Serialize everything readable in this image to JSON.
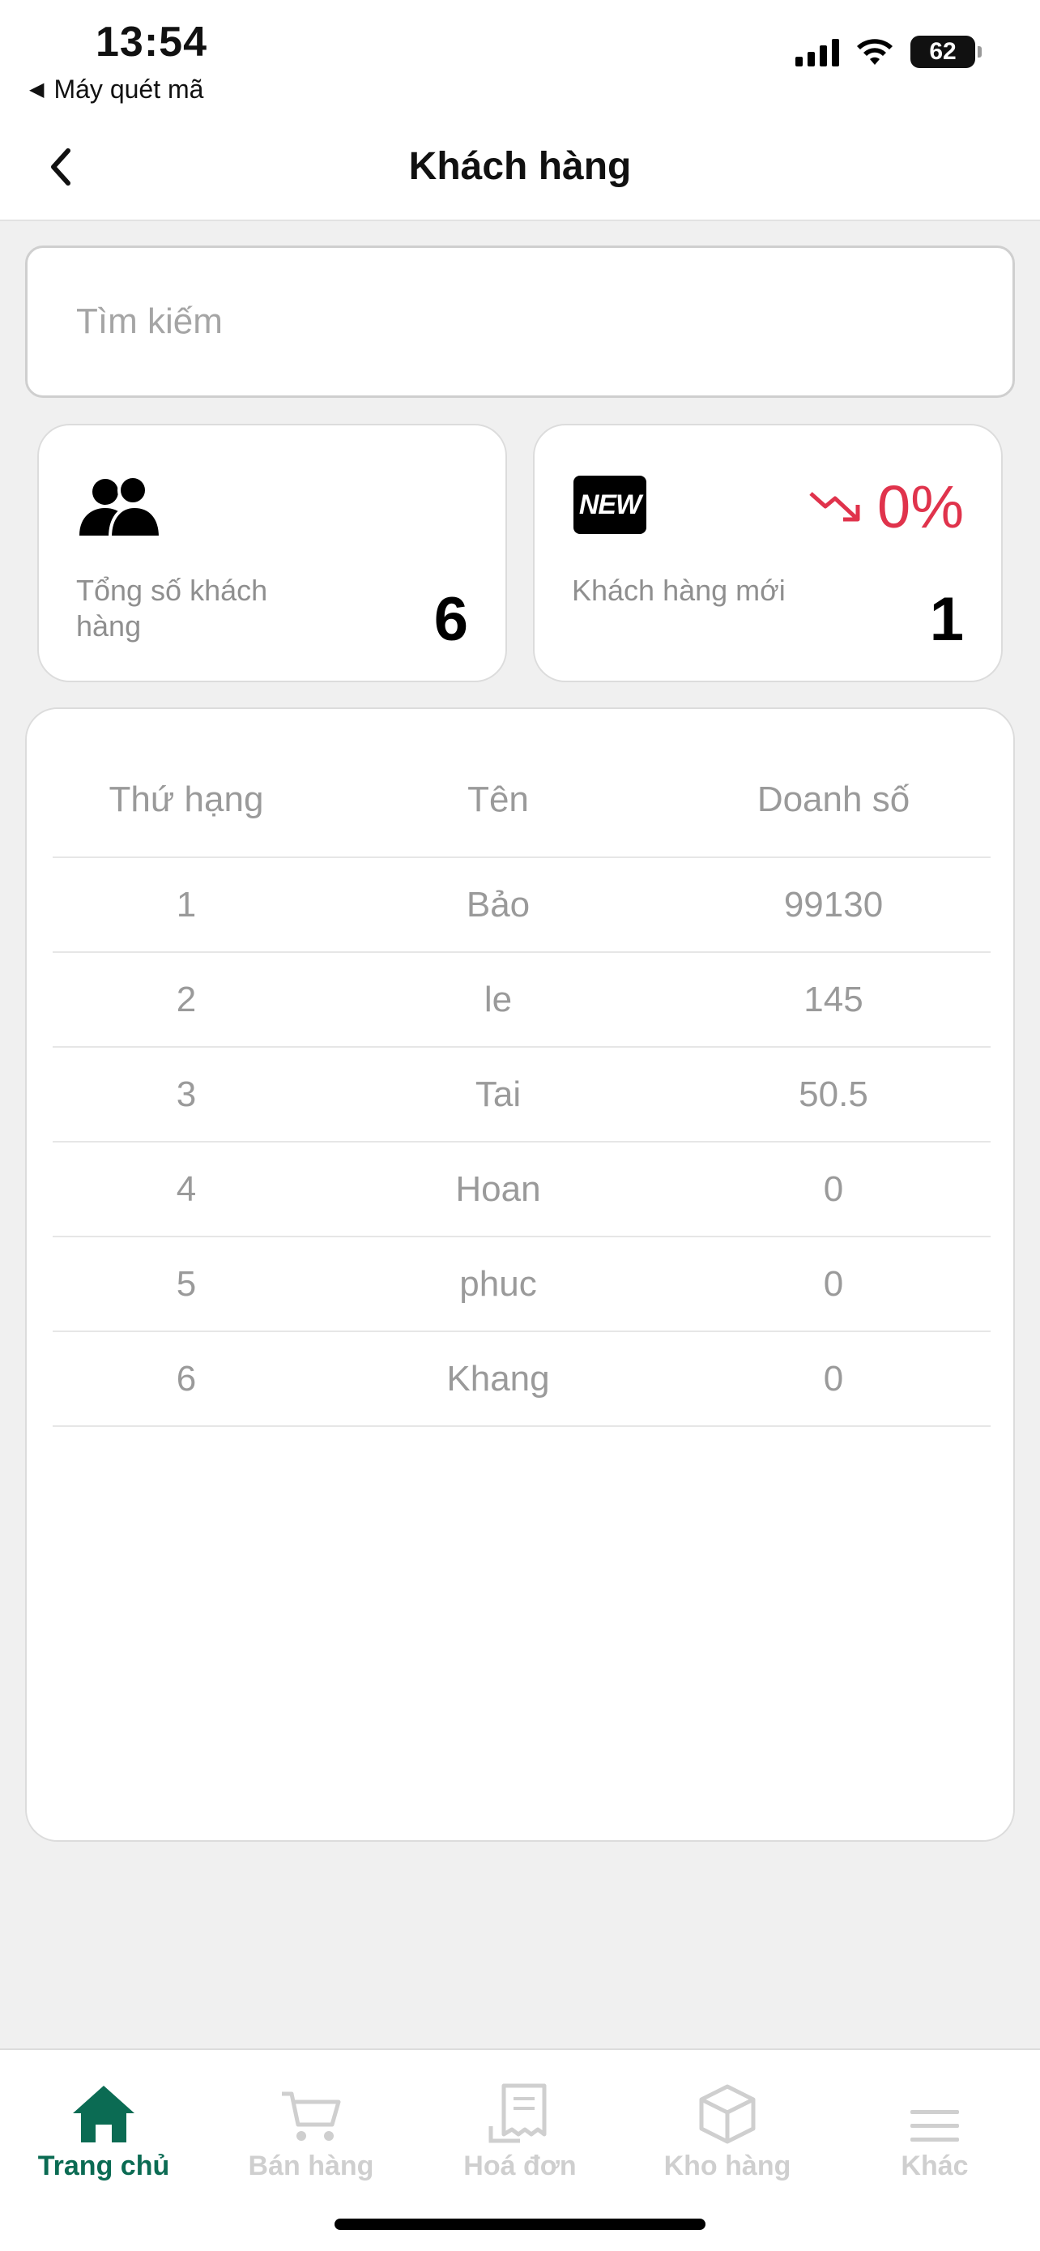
{
  "status_bar": {
    "time": "13:54",
    "back_app": "Máy quét mã",
    "battery": "62"
  },
  "header": {
    "title": "Khách hàng"
  },
  "search": {
    "placeholder": "Tìm kiếm"
  },
  "stats": {
    "total": {
      "label": "Tổng số khách hàng",
      "value": "6",
      "icon": "users-icon"
    },
    "new": {
      "label": "Khách hàng mới",
      "value": "1",
      "trend": "0%",
      "badge": "NEW",
      "icon": "new-badge-icon",
      "trend_icon": "trend-down-icon"
    }
  },
  "colors": {
    "accent": "#0b6b53",
    "trend_down": "#e0334c",
    "muted_text": "#9a9a9a"
  },
  "table": {
    "headers": {
      "rank": "Thứ hạng",
      "name": "Tên",
      "sales": "Doanh số"
    },
    "rows": [
      {
        "rank": "1",
        "name": "Bảo",
        "sales": "99130"
      },
      {
        "rank": "2",
        "name": "le",
        "sales": "145"
      },
      {
        "rank": "3",
        "name": "Tai",
        "sales": "50.5"
      },
      {
        "rank": "4",
        "name": "Hoan",
        "sales": "0"
      },
      {
        "rank": "5",
        "name": "phuc",
        "sales": "0"
      },
      {
        "rank": "6",
        "name": "Khang",
        "sales": "0"
      }
    ]
  },
  "nav": [
    {
      "label": "Trang chủ",
      "icon": "home-icon",
      "active": true
    },
    {
      "label": "Bán hàng",
      "icon": "cart-icon",
      "active": false
    },
    {
      "label": "Hoá đơn",
      "icon": "receipt-icon",
      "active": false
    },
    {
      "label": "Kho hàng",
      "icon": "box-icon",
      "active": false
    },
    {
      "label": "Khác",
      "icon": "menu-icon",
      "active": false
    }
  ]
}
